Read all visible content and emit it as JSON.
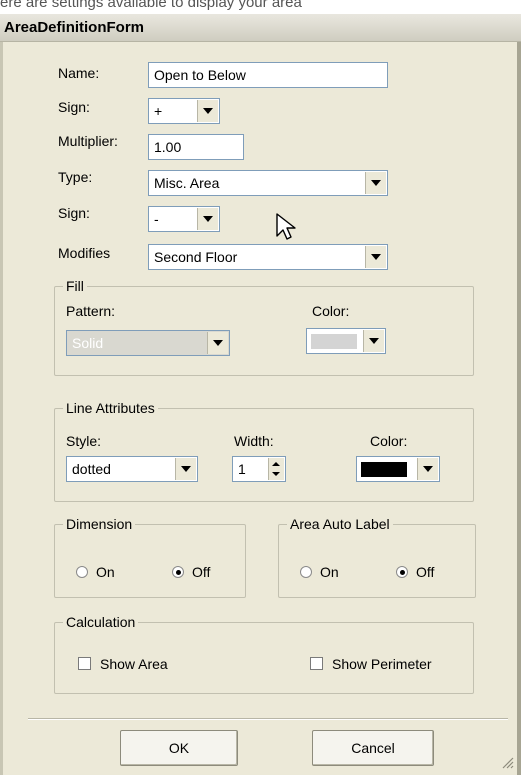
{
  "header_fragment": "ere are settings available to display your area",
  "window": {
    "title": "AreaDefinitionForm"
  },
  "fields": {
    "name": {
      "label": "Name:",
      "value": "Open to Below"
    },
    "sign1": {
      "label": "Sign:",
      "value": "+"
    },
    "multiplier": {
      "label": "Multiplier:",
      "value": "1.00"
    },
    "type": {
      "label": "Type:",
      "value": "Misc. Area"
    },
    "sign2": {
      "label": "Sign:",
      "value": "-"
    },
    "modifies": {
      "label": "Modifies",
      "value": "Second Floor"
    }
  },
  "fill": {
    "legend": "Fill",
    "pattern_label": "Pattern:",
    "pattern_value": "Solid",
    "color_label": "Color:",
    "color_swatch": "#d4d4d4"
  },
  "line_attributes": {
    "legend": "Line Attributes",
    "style_label": "Style:",
    "style_value": "dotted",
    "width_label": "Width:",
    "width_value": "1",
    "color_label": "Color:",
    "color_swatch": "#000000"
  },
  "dimension": {
    "legend": "Dimension",
    "on_label": "On",
    "off_label": "Off",
    "selected": "Off"
  },
  "area_auto_label": {
    "legend": "Area Auto Label",
    "on_label": "On",
    "off_label": "Off",
    "selected": "Off"
  },
  "calculation": {
    "legend": "Calculation",
    "show_area_label": "Show Area",
    "show_area_checked": false,
    "show_perimeter_label": "Show Perimeter",
    "show_perimeter_checked": false
  },
  "buttons": {
    "ok": "OK",
    "cancel": "Cancel"
  }
}
